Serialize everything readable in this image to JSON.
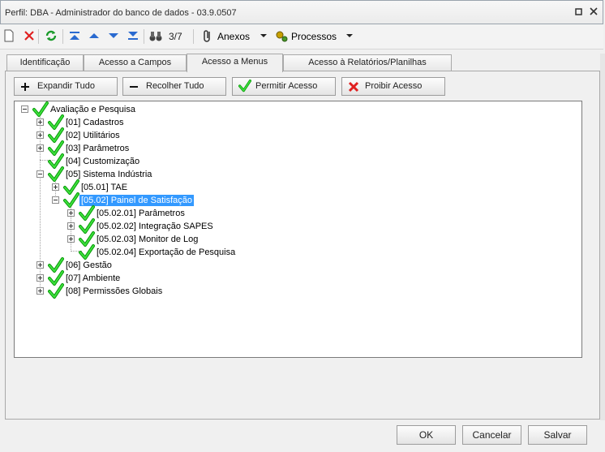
{
  "window": {
    "title": "Perfil: DBA - Administrador do banco de dados - 03.9.0507"
  },
  "toolbar": {
    "record_counter": "3/7",
    "anexos_label": "Anexos",
    "processos_label": "Processos"
  },
  "tabs": [
    {
      "label": "Identificação"
    },
    {
      "label": "Acesso a Campos"
    },
    {
      "label": "Acesso a Menus"
    },
    {
      "label": "Acesso à Relatórios/Planilhas"
    }
  ],
  "actions": {
    "expand_all": "Expandir Tudo",
    "collapse_all": "Recolher Tudo",
    "allow_access": "Permitir Acesso",
    "deny_access": "Proibir Acesso"
  },
  "tree": {
    "root": "Avaliação e Pesquisa",
    "items": [
      "[01] Cadastros",
      "[02] Utilitários",
      "[03] Parâmetros",
      "[04] Customização",
      "[05] Sistema Indústria",
      "[05.01] TAE",
      "[05.02] Painel de Satisfação",
      "[05.02.01] Parâmetros",
      "[05.02.02] Integração SAPES",
      "[05.02.03] Monitor de Log",
      "[05.02.04] Exportação de Pesquisa",
      "[06] Gestão",
      "[07] Ambiente",
      "[08] Permissões Globais"
    ]
  },
  "footer": {
    "ok": "OK",
    "cancel": "Cancelar",
    "save": "Salvar"
  },
  "colors": {
    "selection": "#3399ff",
    "check": "#1ec81e",
    "deny": "#e02020"
  }
}
